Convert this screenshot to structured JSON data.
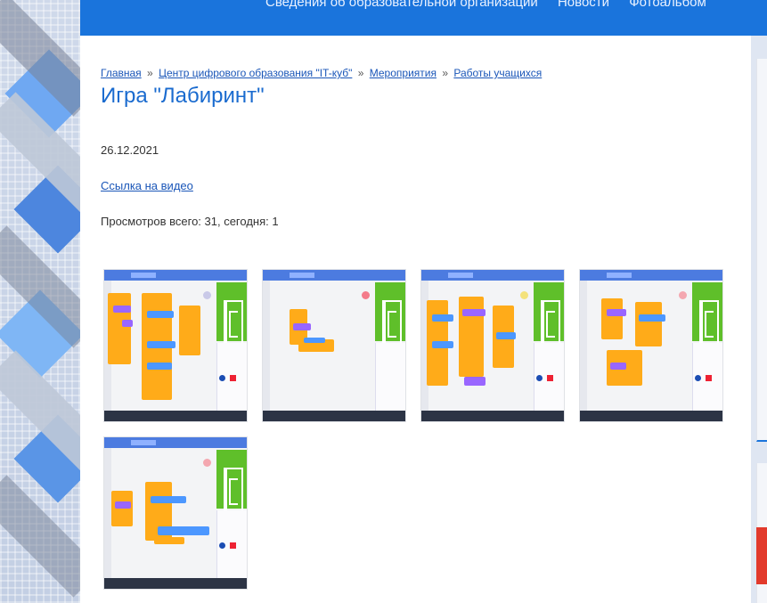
{
  "topnav": {
    "items": [
      "Сведения об образовательной организации",
      "Новости",
      "Фотоальбом"
    ]
  },
  "breadcrumb": {
    "items": [
      "Главная",
      "Центр цифрового образования \"IT-куб\"",
      "Мероприятия",
      "Работы учащихся"
    ],
    "separator": "»"
  },
  "article": {
    "title": "Игра \"Лабиринт\"",
    "date": "26.12.2021",
    "video_link": "Ссылка на видео",
    "views": "Просмотров всего: 31, сегодня: 1"
  },
  "gallery": {
    "thumbnails": [
      {
        "label": "screenshot-1"
      },
      {
        "label": "screenshot-2"
      },
      {
        "label": "screenshot-3"
      },
      {
        "label": "screenshot-4"
      },
      {
        "label": "screenshot-5"
      }
    ]
  },
  "colors": {
    "header_blue": "#1a74dc",
    "link_blue": "#1a56b8",
    "title_blue": "#1a6bcf",
    "scratch_orange": "#ffab19",
    "scratch_purple": "#9966ff",
    "scratch_blue": "#4c97ff",
    "stage_green": "#5fbf2a"
  }
}
